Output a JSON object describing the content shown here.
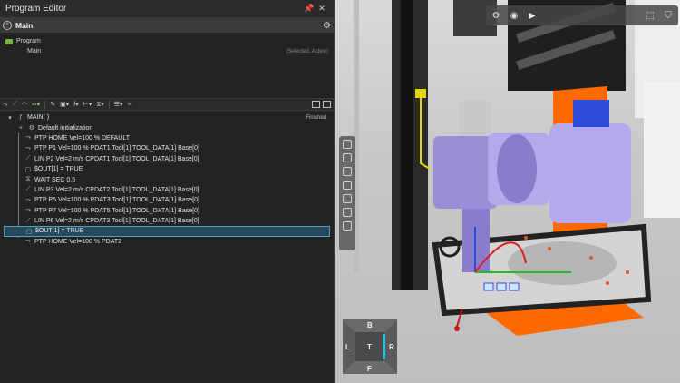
{
  "editor": {
    "title": "Program Editor",
    "pin_icon": "pin-icon",
    "close_icon": "close-icon",
    "main_label": "Main",
    "gear_icon": "gear-icon",
    "programs": [
      {
        "label": "Program",
        "status": ""
      },
      {
        "label": "Main",
        "status": "(Selected, Active)"
      }
    ],
    "code_status": "Finished",
    "code_lines": [
      "MAIN( )",
      "Default initialization",
      "PTP HOME Vel=100 % DEFAULT",
      "PTP P1 Vel=100 % PDAT1 Tool[1]:TOOL_DATA[1] Base[0]",
      "LIN P2 Vel=2 m/s CPDAT1 Tool[1]:TOOL_DATA[1] Base[0]",
      "$OUT[1] = TRUE",
      "WAIT SEC 0.5",
      "LIN P3 Vel=2 m/s CPDAT2 Tool[1]:TOOL_DATA[1] Base[0]",
      "PTP P5 Vel=100 % PDAT3 Tool[1]:TOOL_DATA[1] Base[0]",
      "PTP P7 Vel=100 % PDAT5 Tool[1]:TOOL_DATA[1] Base[0]",
      "LIN P6 Vel=2 m/s CPDAT3 Tool[1]:TOOL_DATA[1] Base[0]",
      "$OUT[1] = TRUE",
      "PTP HOME Vel=100 % PDAT2"
    ]
  },
  "viewport": {
    "navcube": {
      "top": "B",
      "left": "L",
      "center": "T",
      "right": "R",
      "bottom": "F"
    },
    "toolbar_icons": [
      "settings-icon",
      "play-icon",
      "record-icon",
      "camera-icon",
      "filter-icon"
    ]
  },
  "colors": {
    "accent_green": "#9fd36d",
    "selection_blue": "#4aa3c7",
    "robot_purple": "#9b8ed6",
    "orange": "#ff6a00"
  }
}
